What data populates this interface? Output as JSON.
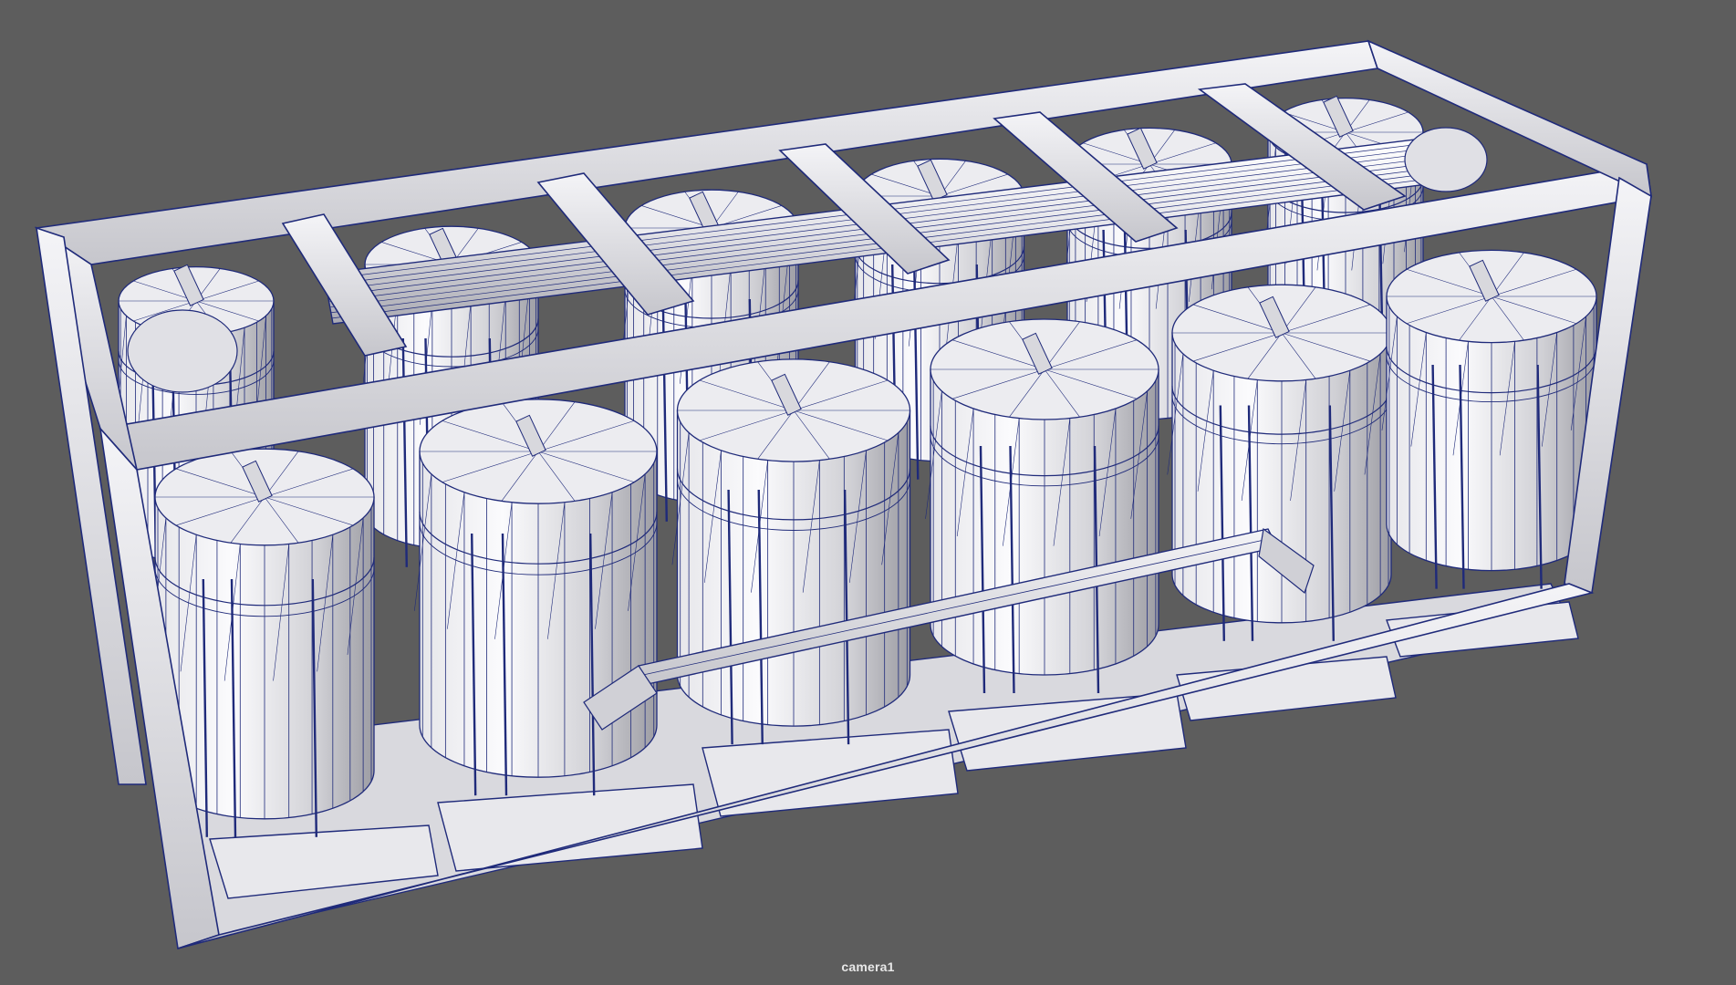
{
  "viewport": {
    "camera_name": "camera1",
    "background_color": "#5d5d5d",
    "display_mode": "wireframe-on-shaded",
    "wire_color": "#1f2a7a",
    "surface_light": "#f2f2f4",
    "surface_mid": "#d4d4d8",
    "surface_dark": "#a8a8ae"
  },
  "scene": {
    "object": "battery-rack",
    "cylinders_front_row": 6,
    "cylinders_back_row": 6
  }
}
